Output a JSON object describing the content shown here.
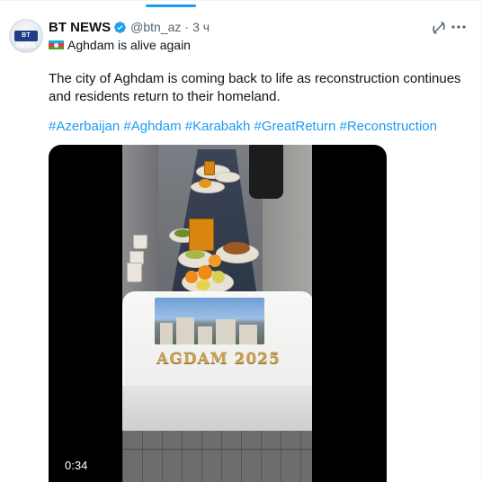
{
  "post": {
    "author_name": "BT NEWS",
    "handle": "@btn_az",
    "separator": "·",
    "time": "3 ч",
    "title_line": "Aghdam is alive again",
    "body": "The city of Aghdam is coming back to life as reconstruction continues and residents return to their homeland.",
    "hashtags": [
      "#Azerbaijan",
      "#Aghdam",
      "#Karabakh",
      "#GreatReturn",
      "#Reconstruction"
    ]
  },
  "avatar": {
    "logo_text": "BT NEWS"
  },
  "icons": {
    "verified": "verified-badge-icon",
    "grok": "grok-icon",
    "more": "more-options-icon",
    "flag": "azerbaijan-flag-icon"
  },
  "media": {
    "duration": "0:34",
    "cake_text": "AGDAM 2025"
  },
  "colors": {
    "accent": "#1d9bf0",
    "text_primary": "#0f1419",
    "text_secondary": "#536471",
    "flag_blue": "#00b5e2",
    "flag_red": "#ef3340",
    "flag_green": "#509e2f"
  }
}
